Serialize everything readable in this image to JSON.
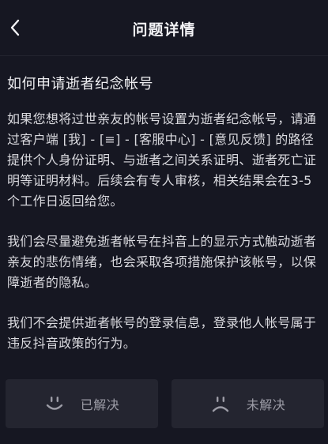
{
  "header": {
    "title": "问题详情",
    "back_icon": "chevron-left-icon"
  },
  "question": {
    "title": "如何申请逝者纪念帐号",
    "paragraphs": [
      "如果您想将过世亲友的帐号设置为逝者纪念帐号，请通过客户端 [我] - [≡] - [客服中心] - [意见反馈] 的路径提供个人身份证明、与逝者之间关系证明、逝者死亡证明等证明材料。后续会有专人审核，相关结果会在3-5个工作日返回给您。",
      "我们会尽量避免逝者帐号在抖音上的显示方式触动逝者亲友的悲伤情绪，也会采取各项措施保护该帐号，以保障逝者的隐私。",
      "我们不会提供逝者帐号的登录信息，登录他人帐号属于违反抖音政策的行为。"
    ]
  },
  "feedback": {
    "resolved_label": "已解决",
    "resolved_icon": "smile-face-icon",
    "unresolved_label": "未解决",
    "unresolved_icon": "frown-face-icon"
  },
  "colors": {
    "background": "#161722",
    "button_background": "#242530",
    "muted_text": "#9c9ca6"
  }
}
